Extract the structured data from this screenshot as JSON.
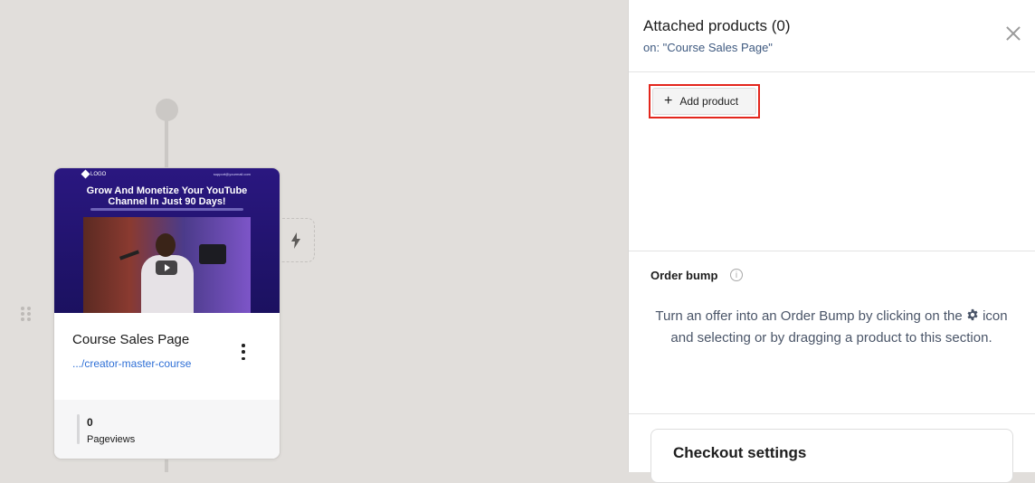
{
  "canvas": {
    "page_card": {
      "thumbnail": {
        "logo_text": "LOGO",
        "email_text": "support@yourmail.com",
        "headline": "Grow And Monetize Your YouTube Channel In Just 90 Days!"
      },
      "title": "Course Sales Page",
      "url": ".../creator-master-course",
      "stats": {
        "value": "0",
        "label": "Pageviews"
      }
    },
    "icons": {
      "automation": "lightning-bolt-icon",
      "menu": "vertical-dots-icon",
      "drag": "drag-handle-icon"
    }
  },
  "panel": {
    "title": "Attached products (0)",
    "subtitle": "on: \"Course Sales Page\"",
    "add_product_label": "Add product",
    "order_bump": {
      "title": "Order bump",
      "desc_before": "Turn an offer into an Order Bump by clicking on the",
      "desc_after": "icon and selecting or by dragging a product to this section."
    },
    "checkout_settings_title": "Checkout settings"
  },
  "colors": {
    "highlight": "#e3261c",
    "link": "#2e6fd6",
    "canvas_bg": "#e1dedb"
  }
}
